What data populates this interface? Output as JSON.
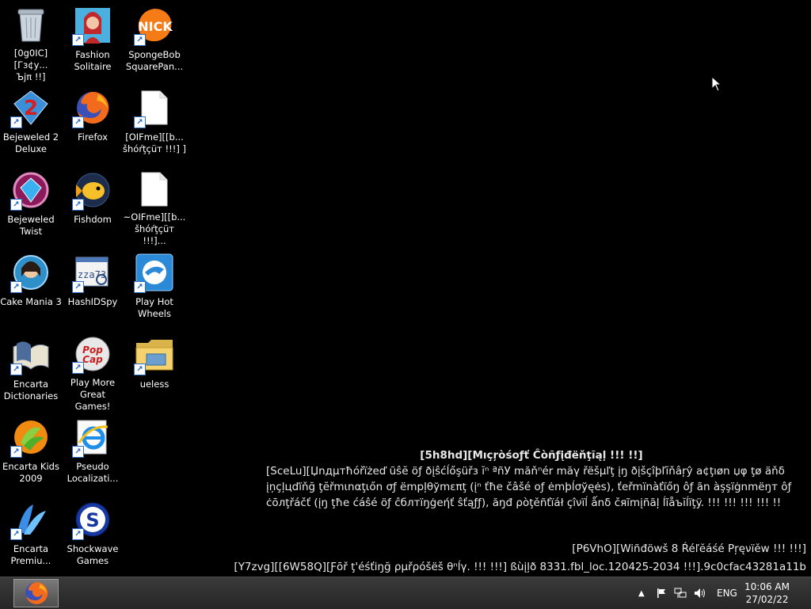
{
  "desktop": {
    "icons": [
      {
        "label": "[0g0IC][Гз¢у...\nЪјπ !!]",
        "icon": "recycle-bin-icon"
      },
      {
        "label": "Bejeweled 2\nDeluxe",
        "icon": "bejeweled-2-icon"
      },
      {
        "label": "Bejeweled\nTwist",
        "icon": "bejeweled-twist-icon"
      },
      {
        "label": "Cake Mania 3",
        "icon": "cake-mania-icon"
      },
      {
        "label": "Encarta\nDictionaries",
        "icon": "encarta-dictionaries-icon"
      },
      {
        "label": "Encarta Kids\n2009",
        "icon": "encarta-kids-icon"
      },
      {
        "label": "Encarta\nPremiu...",
        "icon": "encarta-premium-icon"
      },
      {
        "label": "Fashion\nSolitaire",
        "icon": "fashion-solitaire-icon"
      },
      {
        "label": "Firefox",
        "icon": "firefox-icon"
      },
      {
        "label": "Fishdom",
        "icon": "fishdom-icon"
      },
      {
        "label": "HashIDSpy",
        "icon": "hashidspy-icon"
      },
      {
        "label": "Play More\nGreat Games!",
        "icon": "popcap-icon"
      },
      {
        "label": "Pseudo\nLocalizati...",
        "icon": "internet-explorer-icon"
      },
      {
        "label": "Shockwave\nGames",
        "icon": "shockwave-icon"
      },
      {
        "label": "SpongeBob\nSquarePan...",
        "icon": "nick-icon"
      },
      {
        "label": "[OIFme][[b...\nšhóŕţçüт !!!] ]",
        "icon": "blank-file-icon"
      },
      {
        "label": "~OIFme][[b...\nšhóŕţçüт !!!]...",
        "icon": "blank-file-icon-2"
      },
      {
        "label": "Play Hot\nWheels",
        "icon": "hot-wheels-icon"
      },
      {
        "label": "ueless",
        "icon": "folder-icon"
      }
    ]
  },
  "watermark": {
    "title": "[5h8hd][Мıçŗòśoƒť Ĉòñƒįđëňţĩąļ !!! !!]",
    "body": "[SceLu][Џnдμтħóřïżeď ũŝĕ öƒ ðįŝćĺőşüřз ĭⁿ ªñУ măňⁿér măγ řëšµľţ įŋ ðįšçîþľĭňâŗŷ a¢ţıøn џφ ţø äňδ įņçļцďïňğ ţĕřmιnαţιőn σƒ ëmpļθўmεπţ (įⁿ ťħe čâšé οƒ ėmþĺσўęės), ťeřmïnàťïőŋ ôƒ ãn àşşïġnmëŋт ôƒ ċōлţřáčť (įŋ ţħе ćáŝé öƒ ĉблтїŋġеήť ŝťąƒƒ), ăŋđ ρòţěñťïáł çîνïĺ ǻnδ čяĩmįñãļ ĺĩåъĭĺïţÿ. !!! !!! !!! !!! !!",
    "line1": "[P6VhO][Wiñđöwš 8 Ŕéľĕáśé Ρŗęνïěw !!! !!!]",
    "line2": "[Y7zvg][[6W58Q][Ƒōř ţ'éśťiŋğ ρµřρóšëš θⁿĺγ. !!! !!!] ßùįļð 8331.fbl_loc.120425-2034 !!!].9c0cfac43281a11b"
  },
  "taskbar": {
    "pinned_app": "firefox-icon",
    "language": "ENG",
    "time": "10:06 AM",
    "date": "27/02/22"
  }
}
